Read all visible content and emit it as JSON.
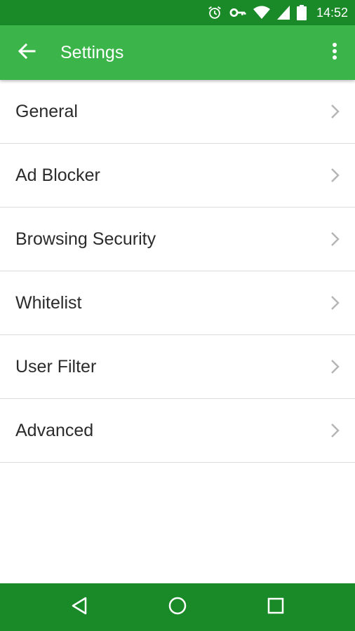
{
  "status_bar": {
    "time": "14:52",
    "icons": [
      "alarm-icon",
      "vpn-key-icon",
      "wifi-icon",
      "cell-signal-icon",
      "battery-icon"
    ]
  },
  "app_bar": {
    "title": "Settings",
    "back_icon": "arrow-back-icon",
    "menu_icon": "more-vert-icon"
  },
  "settings": {
    "items": [
      {
        "label": "General"
      },
      {
        "label": "Ad Blocker"
      },
      {
        "label": "Browsing Security"
      },
      {
        "label": "Whitelist"
      },
      {
        "label": "User Filter"
      },
      {
        "label": "Advanced"
      }
    ]
  },
  "nav_bar": {
    "buttons": [
      "back-triangle-icon",
      "home-circle-icon",
      "recents-square-icon"
    ]
  },
  "colors": {
    "status_bar_bg": "#1a8a28",
    "app_bar_bg": "#3bb54a",
    "nav_bar_bg": "#1a8a28",
    "item_text": "#2b2b2b",
    "divider": "#dcdcdc",
    "chevron": "#b5b5b5"
  }
}
